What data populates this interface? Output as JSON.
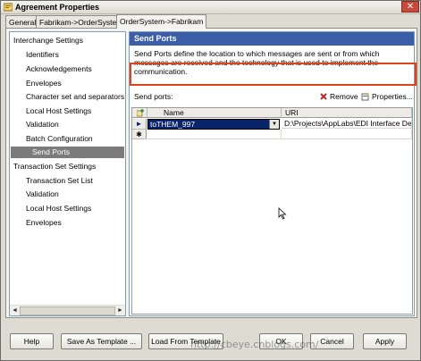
{
  "window": {
    "title": "Agreement Properties",
    "close_glyph": "✕"
  },
  "tabs": [
    {
      "label": "General"
    },
    {
      "label": "Fabrikam->OrderSystem"
    },
    {
      "label": "OrderSystem->Fabrikam"
    }
  ],
  "tree": {
    "items": [
      {
        "label": "Interchange Settings"
      },
      {
        "label": "Identifiers"
      },
      {
        "label": "Acknowledgements"
      },
      {
        "label": "Envelopes"
      },
      {
        "label": "Character set and separators"
      },
      {
        "label": "Local Host Settings"
      },
      {
        "label": "Validation"
      },
      {
        "label": "Batch Configuration"
      },
      {
        "label": "Send Ports"
      },
      {
        "label": "Transaction Set Settings"
      },
      {
        "label": "Transaction Set List"
      },
      {
        "label": "Validation"
      },
      {
        "label": "Local Host Settings"
      },
      {
        "label": "Envelopes"
      }
    ],
    "scroll_left": "◄",
    "scroll_right": "►"
  },
  "panel": {
    "header": "Send Ports",
    "description": "Send Ports define the location to which messages are sent or from which messages are received and the technology that is used to implement the communication.",
    "send_ports_label": "Send ports:",
    "remove_label": "Remove",
    "properties_label": "Properties..."
  },
  "grid": {
    "columns": [
      "Name",
      "URI"
    ],
    "rows": [
      {
        "marker": "►",
        "name": "toTHEM_997",
        "uri": "D:\\Projects\\AppLabs\\EDI Interface De..."
      },
      {
        "marker": "✱",
        "name": "",
        "uri": ""
      }
    ]
  },
  "buttons": {
    "help": "Help",
    "save_as_template": "Save As Template ...",
    "load_from_template": "Load From Template",
    "ok": "OK",
    "cancel": "Cancel",
    "apply": "Apply"
  },
  "watermark": "http://cbeye.cnblogs.com/",
  "colors": {
    "header": "#3c5ea8",
    "highlight": "#e0421c",
    "selection": "#0a246a"
  }
}
